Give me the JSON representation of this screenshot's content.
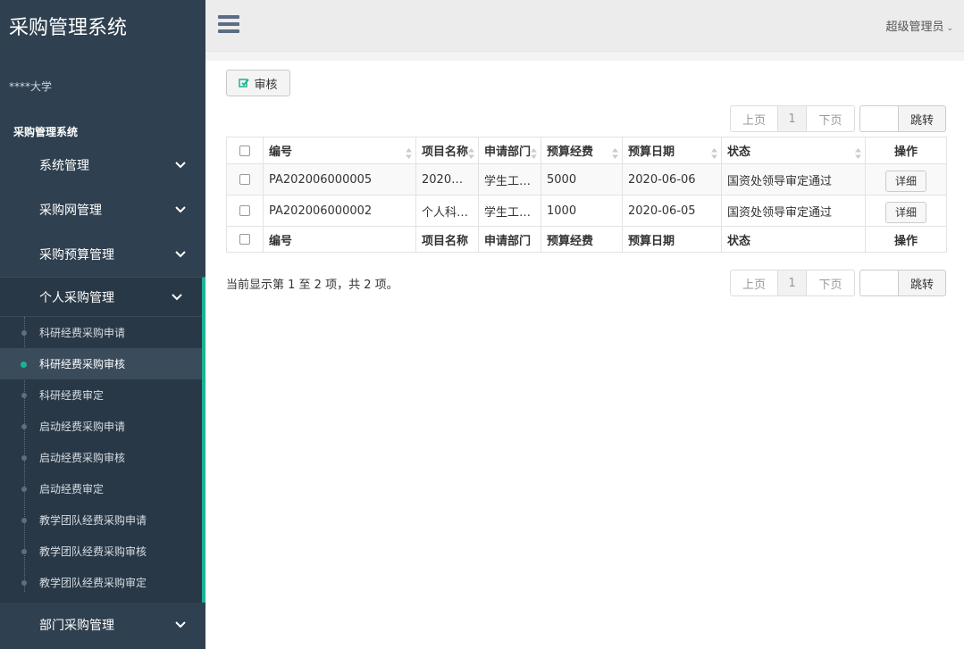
{
  "app": {
    "title": "采购管理系统",
    "org": "****大学",
    "user": "超级管理员"
  },
  "sidebar": {
    "section_title": "采购管理系统",
    "items": [
      {
        "label": "系统管理"
      },
      {
        "label": "采购网管理"
      },
      {
        "label": "采购预算管理"
      }
    ],
    "open_group": {
      "label": "个人采购管理",
      "children": [
        {
          "label": "科研经费采购申请"
        },
        {
          "label": "科研经费采购审核"
        },
        {
          "label": "科研经费审定"
        },
        {
          "label": "启动经费采购申请"
        },
        {
          "label": "启动经费采购审核"
        },
        {
          "label": "启动经费审定"
        },
        {
          "label": "教学团队经费采购申请"
        },
        {
          "label": "教学团队经费采购审核"
        },
        {
          "label": "教学团队经费采购审定"
        }
      ],
      "active_index": 1
    },
    "after_items": [
      {
        "label": "部门采购管理"
      }
    ]
  },
  "toolbar": {
    "audit_label": "审核"
  },
  "pager": {
    "prev": "上页",
    "page": "1",
    "next": "下页",
    "jump": "跳转"
  },
  "table": {
    "columns": [
      "编号",
      "项目名称",
      "申请部门",
      "预算经费",
      "预算日期",
      "状态",
      "操作"
    ],
    "rows": [
      {
        "id": "PA202006000005",
        "name": "2020…",
        "dept": "学生工…",
        "budget": "5000",
        "date": "2020-06-06",
        "status": "国资处领导审定通过",
        "action": "详细"
      },
      {
        "id": "PA202006000002",
        "name": "个人科…",
        "dept": "学生工…",
        "budget": "1000",
        "date": "2020-06-05",
        "status": "国资处领导审定通过",
        "action": "详细"
      }
    ]
  },
  "summary": "当前显示第 1 至 2 项，共 2 项。",
  "colors": {
    "sidebar_bg": "#2f4050",
    "accent": "#1ab394",
    "topbar_bg": "#ececec"
  }
}
